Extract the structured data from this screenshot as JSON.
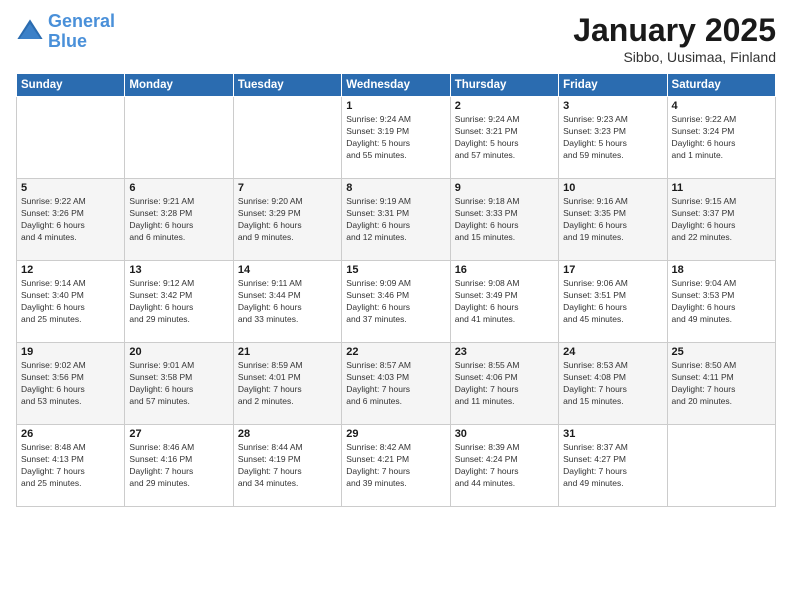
{
  "header": {
    "logo_line1": "General",
    "logo_line2": "Blue",
    "month": "January 2025",
    "location": "Sibbo, Uusimaa, Finland"
  },
  "days_of_week": [
    "Sunday",
    "Monday",
    "Tuesday",
    "Wednesday",
    "Thursday",
    "Friday",
    "Saturday"
  ],
  "weeks": [
    [
      {
        "day": "",
        "info": ""
      },
      {
        "day": "",
        "info": ""
      },
      {
        "day": "",
        "info": ""
      },
      {
        "day": "1",
        "info": "Sunrise: 9:24 AM\nSunset: 3:19 PM\nDaylight: 5 hours\nand 55 minutes."
      },
      {
        "day": "2",
        "info": "Sunrise: 9:24 AM\nSunset: 3:21 PM\nDaylight: 5 hours\nand 57 minutes."
      },
      {
        "day": "3",
        "info": "Sunrise: 9:23 AM\nSunset: 3:23 PM\nDaylight: 5 hours\nand 59 minutes."
      },
      {
        "day": "4",
        "info": "Sunrise: 9:22 AM\nSunset: 3:24 PM\nDaylight: 6 hours\nand 1 minute."
      }
    ],
    [
      {
        "day": "5",
        "info": "Sunrise: 9:22 AM\nSunset: 3:26 PM\nDaylight: 6 hours\nand 4 minutes."
      },
      {
        "day": "6",
        "info": "Sunrise: 9:21 AM\nSunset: 3:28 PM\nDaylight: 6 hours\nand 6 minutes."
      },
      {
        "day": "7",
        "info": "Sunrise: 9:20 AM\nSunset: 3:29 PM\nDaylight: 6 hours\nand 9 minutes."
      },
      {
        "day": "8",
        "info": "Sunrise: 9:19 AM\nSunset: 3:31 PM\nDaylight: 6 hours\nand 12 minutes."
      },
      {
        "day": "9",
        "info": "Sunrise: 9:18 AM\nSunset: 3:33 PM\nDaylight: 6 hours\nand 15 minutes."
      },
      {
        "day": "10",
        "info": "Sunrise: 9:16 AM\nSunset: 3:35 PM\nDaylight: 6 hours\nand 19 minutes."
      },
      {
        "day": "11",
        "info": "Sunrise: 9:15 AM\nSunset: 3:37 PM\nDaylight: 6 hours\nand 22 minutes."
      }
    ],
    [
      {
        "day": "12",
        "info": "Sunrise: 9:14 AM\nSunset: 3:40 PM\nDaylight: 6 hours\nand 25 minutes."
      },
      {
        "day": "13",
        "info": "Sunrise: 9:12 AM\nSunset: 3:42 PM\nDaylight: 6 hours\nand 29 minutes."
      },
      {
        "day": "14",
        "info": "Sunrise: 9:11 AM\nSunset: 3:44 PM\nDaylight: 6 hours\nand 33 minutes."
      },
      {
        "day": "15",
        "info": "Sunrise: 9:09 AM\nSunset: 3:46 PM\nDaylight: 6 hours\nand 37 minutes."
      },
      {
        "day": "16",
        "info": "Sunrise: 9:08 AM\nSunset: 3:49 PM\nDaylight: 6 hours\nand 41 minutes."
      },
      {
        "day": "17",
        "info": "Sunrise: 9:06 AM\nSunset: 3:51 PM\nDaylight: 6 hours\nand 45 minutes."
      },
      {
        "day": "18",
        "info": "Sunrise: 9:04 AM\nSunset: 3:53 PM\nDaylight: 6 hours\nand 49 minutes."
      }
    ],
    [
      {
        "day": "19",
        "info": "Sunrise: 9:02 AM\nSunset: 3:56 PM\nDaylight: 6 hours\nand 53 minutes."
      },
      {
        "day": "20",
        "info": "Sunrise: 9:01 AM\nSunset: 3:58 PM\nDaylight: 6 hours\nand 57 minutes."
      },
      {
        "day": "21",
        "info": "Sunrise: 8:59 AM\nSunset: 4:01 PM\nDaylight: 7 hours\nand 2 minutes."
      },
      {
        "day": "22",
        "info": "Sunrise: 8:57 AM\nSunset: 4:03 PM\nDaylight: 7 hours\nand 6 minutes."
      },
      {
        "day": "23",
        "info": "Sunrise: 8:55 AM\nSunset: 4:06 PM\nDaylight: 7 hours\nand 11 minutes."
      },
      {
        "day": "24",
        "info": "Sunrise: 8:53 AM\nSunset: 4:08 PM\nDaylight: 7 hours\nand 15 minutes."
      },
      {
        "day": "25",
        "info": "Sunrise: 8:50 AM\nSunset: 4:11 PM\nDaylight: 7 hours\nand 20 minutes."
      }
    ],
    [
      {
        "day": "26",
        "info": "Sunrise: 8:48 AM\nSunset: 4:13 PM\nDaylight: 7 hours\nand 25 minutes."
      },
      {
        "day": "27",
        "info": "Sunrise: 8:46 AM\nSunset: 4:16 PM\nDaylight: 7 hours\nand 29 minutes."
      },
      {
        "day": "28",
        "info": "Sunrise: 8:44 AM\nSunset: 4:19 PM\nDaylight: 7 hours\nand 34 minutes."
      },
      {
        "day": "29",
        "info": "Sunrise: 8:42 AM\nSunset: 4:21 PM\nDaylight: 7 hours\nand 39 minutes."
      },
      {
        "day": "30",
        "info": "Sunrise: 8:39 AM\nSunset: 4:24 PM\nDaylight: 7 hours\nand 44 minutes."
      },
      {
        "day": "31",
        "info": "Sunrise: 8:37 AM\nSunset: 4:27 PM\nDaylight: 7 hours\nand 49 minutes."
      },
      {
        "day": "",
        "info": ""
      }
    ]
  ]
}
